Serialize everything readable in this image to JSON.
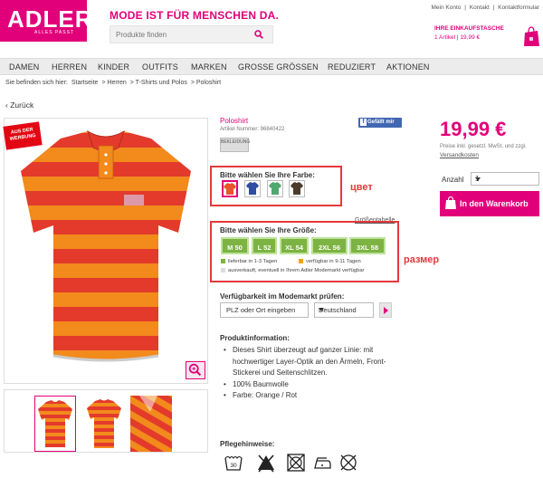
{
  "header": {
    "logo_brand": "ADLER",
    "logo_sub": "ALLES PASST",
    "tagline": "MODE IST FÜR MENSCHEN DA.",
    "search_placeholder": "Produkte finden",
    "top_links": [
      "Mein Konto",
      "|",
      "Kontakt",
      "|",
      "Kontaktformular"
    ],
    "cart_title": "IHRE EINKAUFSTASCHE",
    "cart_summary": "1 Artikel | 19,99 €"
  },
  "nav": {
    "items": [
      "DAMEN",
      "HERREN",
      "KINDER",
      "OUTFITS",
      "MARKEN",
      "GROSSE GRÖSSEN",
      "REDUZIERT",
      "AKTIONEN"
    ]
  },
  "breadcrumb": [
    "Sie befinden sich hier:",
    "Startseite",
    "> Herren",
    "> T-Shirts und Polos",
    "> Poloshirt"
  ],
  "back_label": "Zurück",
  "badge": {
    "line1": "AUS DER",
    "line2": "WERBUNG"
  },
  "product": {
    "name": "Poloshirt",
    "article": "Artikel Nummer: 96840422",
    "like_label": "Gefällt mir",
    "brand_logo_text": "BEKLEIDUNG"
  },
  "color_section": {
    "label": "Bitte wählen Sie Ihre Farbe:",
    "annotation": "цвет",
    "swatches": [
      {
        "name": "Orange / Rot",
        "color": "#e8552a",
        "selected": true
      },
      {
        "name": "Blau",
        "color": "#2f4ea0",
        "selected": false
      },
      {
        "name": "Grün",
        "color": "#4fa86e",
        "selected": false
      },
      {
        "name": "Braun",
        "color": "#4a3b2a",
        "selected": false
      }
    ]
  },
  "size_section": {
    "label": "Bitte wählen Sie Ihre Größe:",
    "annotation": "размер",
    "chart_link": "Größentabelle",
    "sizes": [
      "M 50",
      "L 52",
      "XL 54",
      "2XL 56",
      "3XL 58"
    ],
    "legend": [
      {
        "text": "lieferbar in 1-3 Tagen",
        "color": "#7cb342"
      },
      {
        "text": "verfügbar in 9-11 Tagen",
        "color": "#f0a30a"
      },
      {
        "text": "ausverkauft, eventuell in Ihrem Adler Modemarkt verfügbar",
        "color": "#dddddd"
      }
    ]
  },
  "availability": {
    "label": "Verfügbarkeit im Modemarkt prüfen:",
    "plz_value": "PLZ oder Ort eingeben",
    "country": "Deutschland"
  },
  "info": {
    "title": "Produktinformation:",
    "bullets": [
      "Dieses Shirt überzeugt auf ganzer Linie: mit hochwertiger Layer-Optik an den Ärmeln, Front-Stickerei und Seitenschlitzen.",
      "100% Baumwolle",
      "Farbe: Orange / Rot"
    ]
  },
  "care": {
    "title": "Pflegehinweise:",
    "wash_temp": "30"
  },
  "purchase": {
    "price": "19,99 €",
    "vat": "Preise inkl. gesetzl. MwSt. und zzgl.",
    "shipping": "Versandkosten",
    "qty_label": "Anzahl",
    "qty_value": "1",
    "add_to_cart": "In den Warenkorb"
  },
  "colors": {
    "brand_magenta": "#e2007a",
    "annotation_red": "#e4393c",
    "size_green": "#7cb342",
    "stripe_orange": "#f28a1c",
    "stripe_red": "#e33a2c"
  }
}
